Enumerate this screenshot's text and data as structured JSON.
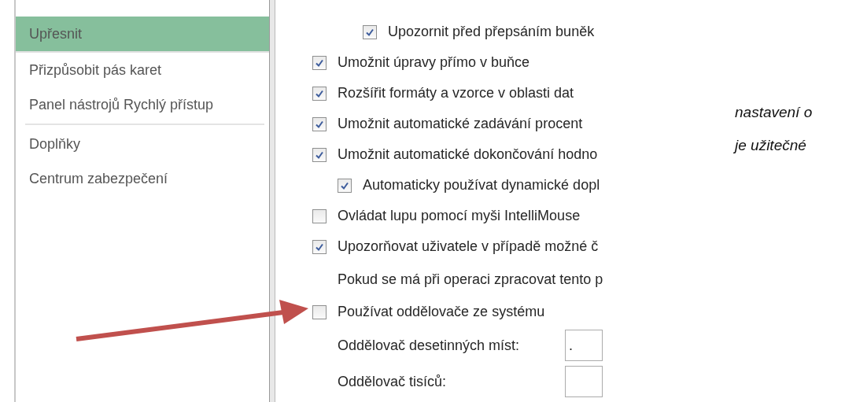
{
  "sidebar": {
    "groups": [
      {
        "items": [
          {
            "label": "Upřesnit",
            "selected": true
          },
          {
            "label": "Přizpůsobit pás karet",
            "selected": false
          },
          {
            "label": "Panel nástrojů Rychlý přístup",
            "selected": false
          }
        ]
      },
      {
        "items": [
          {
            "label": "Doplňky",
            "selected": false
          },
          {
            "label": "Centrum zabezpečení",
            "selected": false
          }
        ]
      }
    ]
  },
  "options": [
    {
      "kind": "group",
      "children": [
        {
          "kind": "checkbox",
          "label": "Upozornit před přepsáním buněk",
          "checked": true
        }
      ]
    },
    {
      "kind": "checkbox",
      "label": "Umožnit úpravy přímo v buňce",
      "checked": true
    },
    {
      "kind": "checkbox",
      "label": "Rozšířit formáty a vzorce v oblasti dat",
      "checked": true
    },
    {
      "kind": "checkbox",
      "label": "Umožnit automatické zadávání procent",
      "checked": true
    },
    {
      "kind": "checkbox",
      "label": "Umožnit automatické dokončování hodno",
      "checked": true,
      "children": [
        {
          "kind": "checkbox",
          "label": "Automaticky používat dynamické dopl",
          "checked": true
        }
      ]
    },
    {
      "kind": "checkbox",
      "label": "Ovládat lupu pomocí myši IntelliMouse",
      "checked": false
    },
    {
      "kind": "checkbox",
      "label": "Upozorňovat uživatele v případě možné č",
      "checked": true
    },
    {
      "kind": "text",
      "label": "Pokud se má při operaci zpracovat tento p"
    },
    {
      "kind": "checkbox",
      "label": "Používat oddělovače ze systému",
      "checked": false,
      "children": [
        {
          "kind": "field",
          "label": "Oddělovač desetinných míst:",
          "value": "."
        },
        {
          "kind": "field",
          "label": "Oddělovač tisíců:"
        }
      ]
    }
  ],
  "note": {
    "lines": [
      "nastavení o",
      "je užitečné"
    ]
  },
  "annotation": {
    "kind": "arrow"
  }
}
